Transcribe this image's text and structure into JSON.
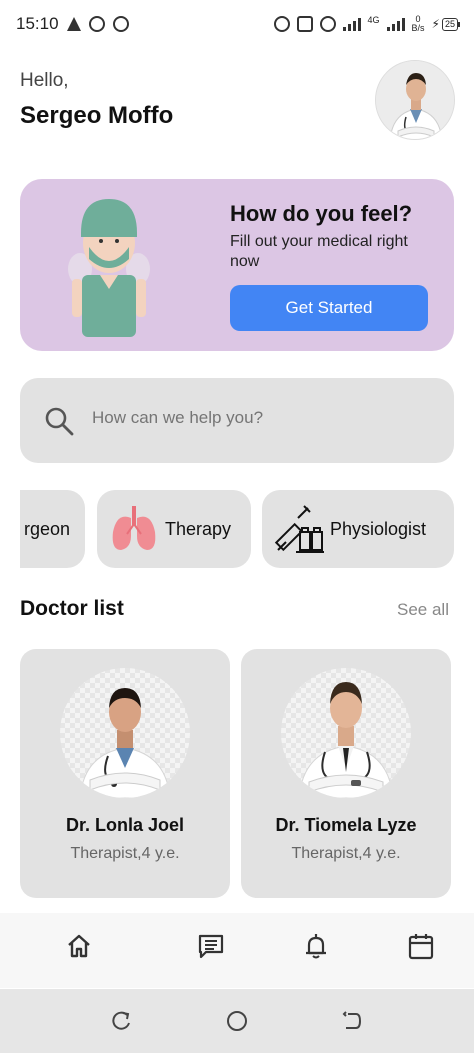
{
  "status_bar": {
    "time": "15:10",
    "network": "4G",
    "speed_value": "0",
    "speed_unit": "B/s",
    "battery": "25"
  },
  "header": {
    "greeting": "Hello,",
    "user_name": "Sergeo Moffo"
  },
  "hero_card": {
    "title": "How do you feel?",
    "subtitle": "Fill out your medical right now",
    "button_label": "Get Started",
    "background_color": "#dcc6e4",
    "button_color": "#4285f4"
  },
  "search": {
    "placeholder": "How can we help you?"
  },
  "categories": [
    {
      "label": "rgeon",
      "icon": "surgeon-icon"
    },
    {
      "label": "Therapy",
      "icon": "lungs-icon"
    },
    {
      "label": "Physiologist",
      "icon": "syringe-vials-icon"
    }
  ],
  "doctor_section": {
    "title": "Doctor list",
    "see_all": "See all"
  },
  "doctors": [
    {
      "name": "Dr. Lonla Joel",
      "role": "Therapist,4 y.e."
    },
    {
      "name": "Dr. Tiomela Lyze",
      "role": "Therapist,4 y.e."
    }
  ],
  "bottom_nav": [
    {
      "icon": "home-icon",
      "active": true
    },
    {
      "icon": "chat-icon",
      "active": false
    },
    {
      "icon": "bell-icon",
      "active": false
    },
    {
      "icon": "calendar-icon",
      "active": false
    }
  ]
}
